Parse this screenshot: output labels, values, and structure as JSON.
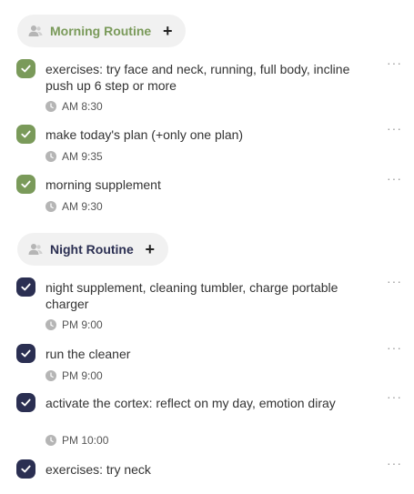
{
  "colors": {
    "morning_accent": "#7a9a5a",
    "night_accent": "#2b2f52",
    "pill_bg": "#f1f1f1",
    "icon_gray": "#b5b5b5"
  },
  "sections": [
    {
      "title": "Morning Routine",
      "add_label": "+",
      "icon": "person-icon",
      "tasks": [
        {
          "text": "exercises: try face and neck, running, full body, incline push up 6 step or more",
          "time": "AM 8:30",
          "checked": true
        },
        {
          "text": "make today's plan (+only one plan)",
          "time": "AM 9:35",
          "checked": true
        },
        {
          "text": "morning supplement",
          "time": "AM 9:30",
          "checked": true
        }
      ]
    },
    {
      "title": "Night Routine",
      "add_label": "+",
      "icon": "person-icon",
      "tasks": [
        {
          "text": "night supplement, cleaning tumbler, charge portable charger",
          "time": "PM 9:00",
          "checked": true
        },
        {
          "text": "run the cleaner",
          "time": "PM 9:00",
          "checked": true
        },
        {
          "text": "activate the cortex: reflect on my day, emotion diray",
          "time": "PM 10:00",
          "checked": true
        },
        {
          "text": "exercises: try neck",
          "time": "",
          "checked": true
        }
      ]
    }
  ],
  "more_label": "···"
}
